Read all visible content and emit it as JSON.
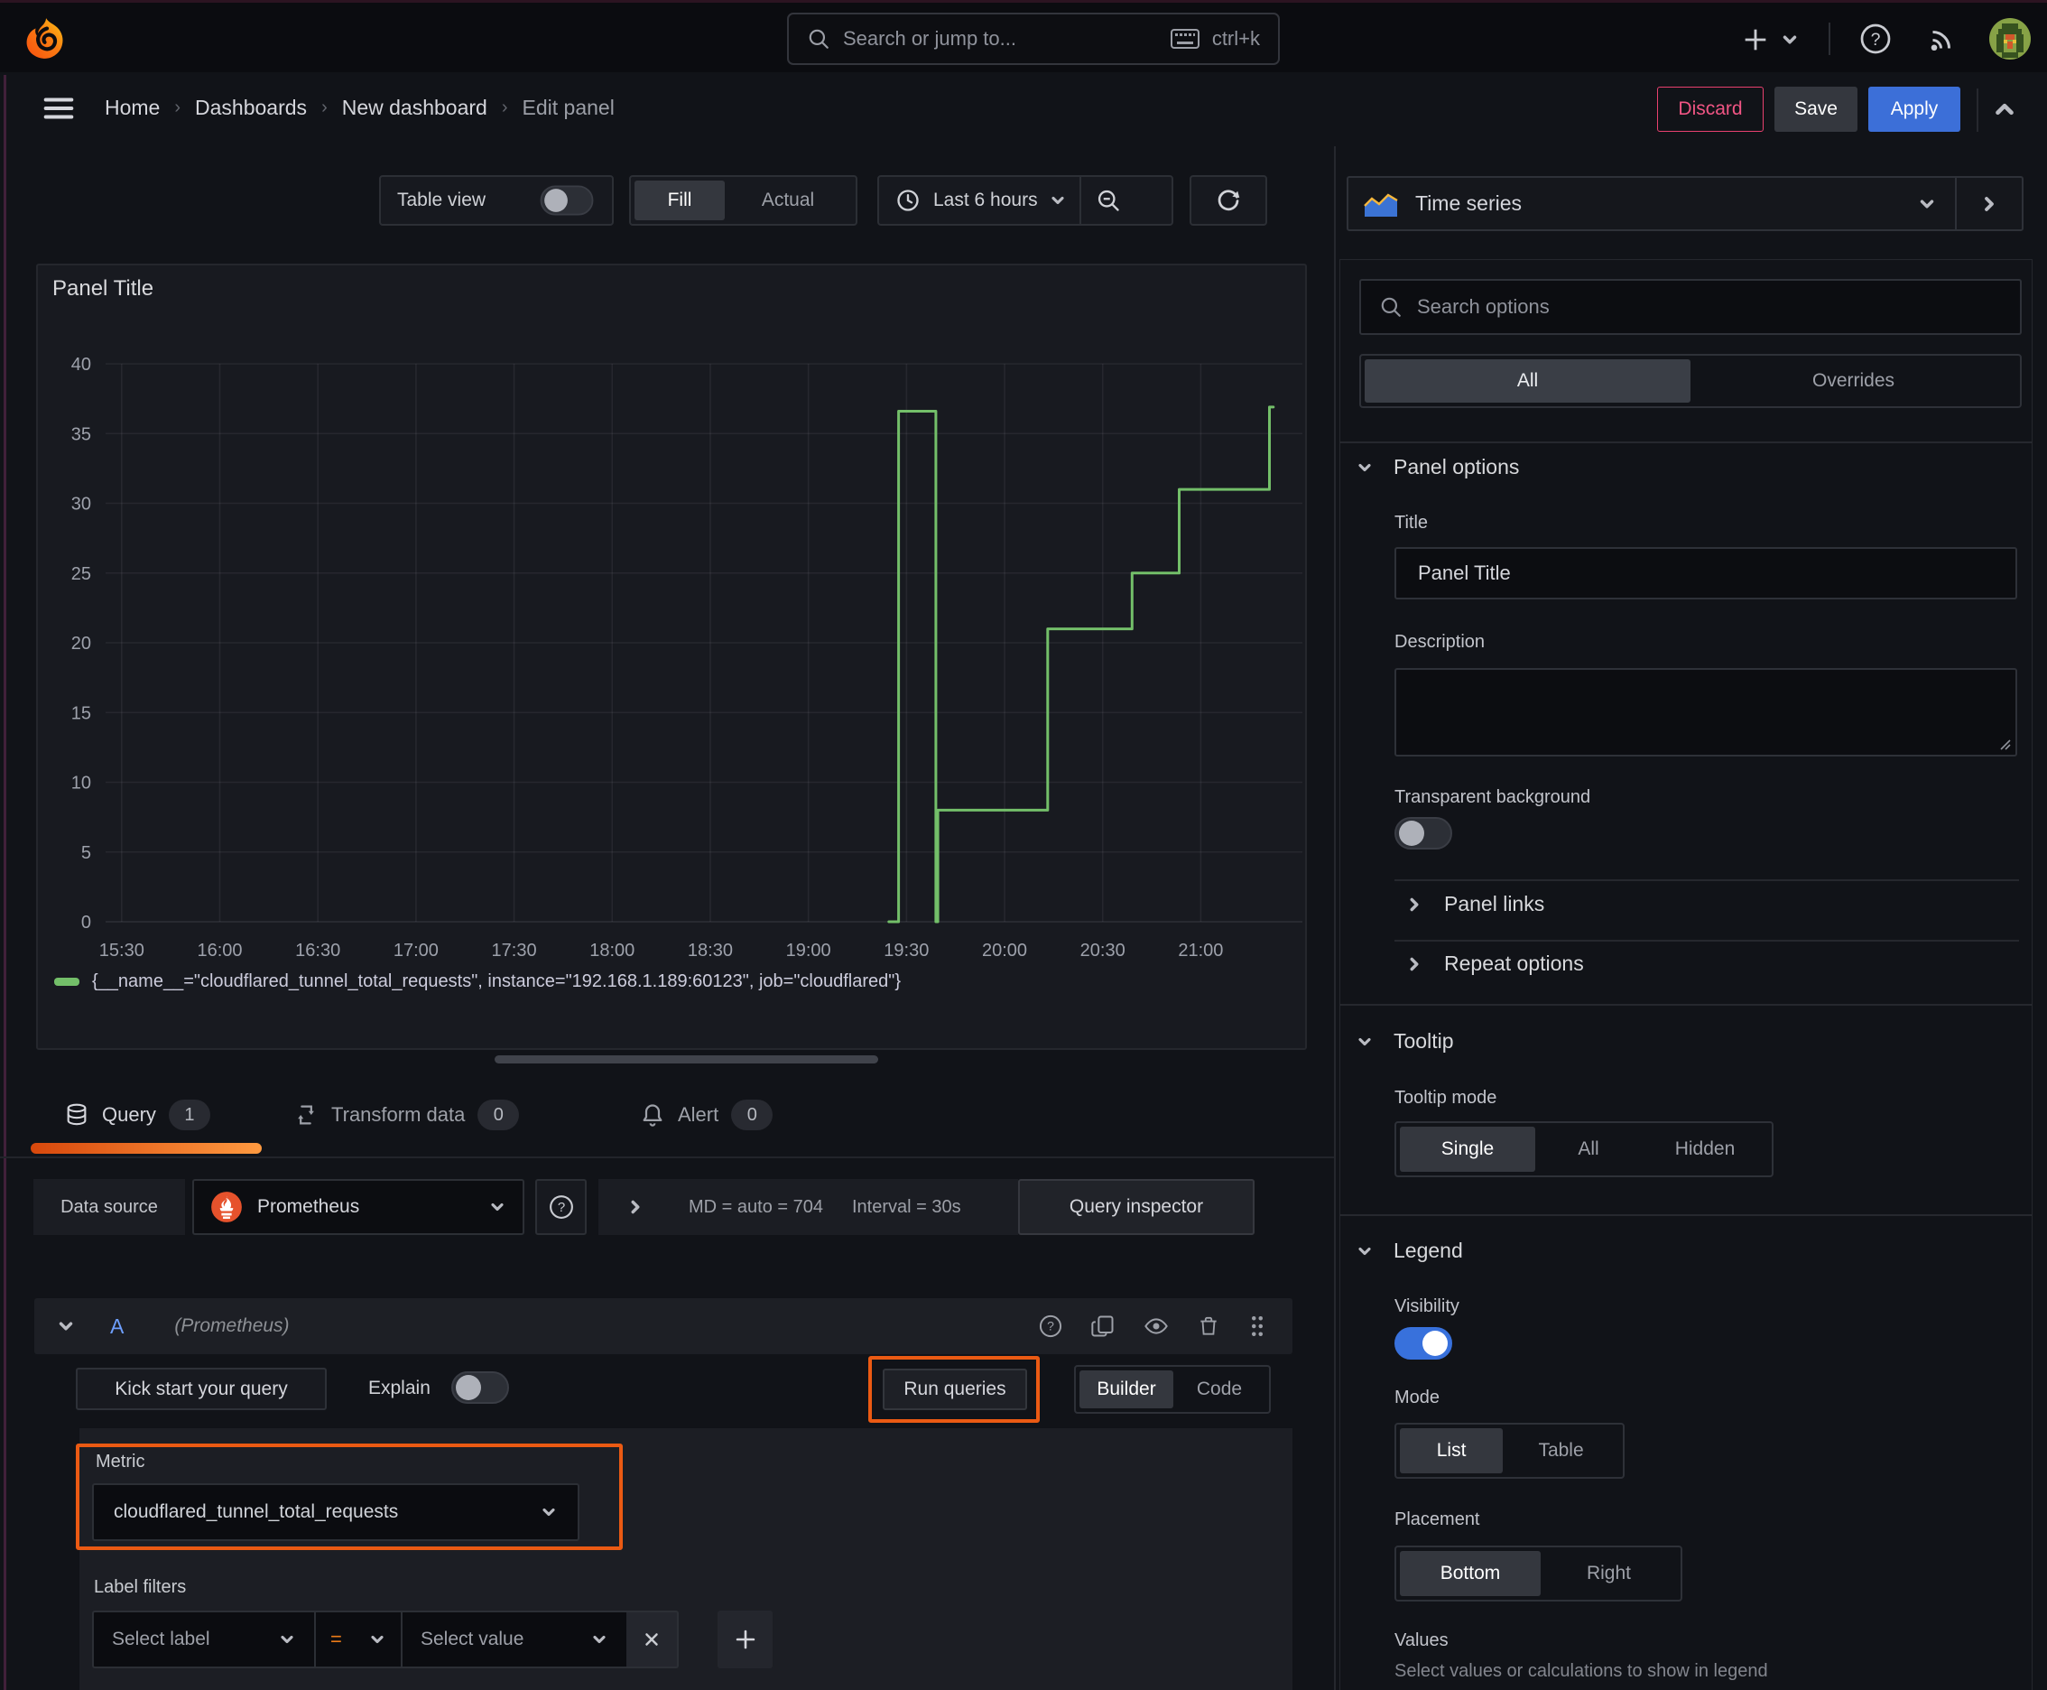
{
  "topbar": {
    "search_placeholder": "Search or jump to...",
    "shortcut": "ctrl+k"
  },
  "breadcrumb": {
    "items": [
      "Home",
      "Dashboards",
      "New dashboard",
      "Edit panel"
    ]
  },
  "actions": {
    "discard": "Discard",
    "save": "Save",
    "apply": "Apply"
  },
  "toolbar": {
    "table_view": "Table view",
    "fill": "Fill",
    "actual": "Actual",
    "time_range": "Last 6 hours"
  },
  "panel": {
    "title": "Panel Title"
  },
  "chart_data": {
    "type": "line",
    "title": "Panel Title",
    "line_style": "step-after",
    "x_tick_labels": [
      "15:30",
      "16:00",
      "16:30",
      "17:00",
      "17:30",
      "18:00",
      "18:30",
      "19:00",
      "19:30",
      "20:00",
      "20:30",
      "21:00"
    ],
    "x_tick_hours": [
      15.5,
      16,
      16.5,
      17,
      17.5,
      18,
      18.5,
      19,
      19.5,
      20,
      20.5,
      21
    ],
    "x_range_hours": [
      15.418,
      21.518
    ],
    "ylim": [
      0,
      40
    ],
    "y_ticks": [
      0,
      5,
      10,
      15,
      20,
      25,
      30,
      35,
      40
    ],
    "grid": true,
    "legend_position": "bottom",
    "series": [
      {
        "name": "{__name__=\"cloudflared_tunnel_total_requests\", instance=\"192.168.1.189:60123\", job=\"cloudflared\"}",
        "color": "#73bf69",
        "points_hours_value": [
          [
            19.41,
            0
          ],
          [
            19.46,
            0
          ],
          [
            19.46,
            36.6
          ],
          [
            19.65,
            36.6
          ],
          [
            19.65,
            0
          ],
          [
            19.66,
            0
          ],
          [
            19.66,
            8
          ],
          [
            20.22,
            8
          ],
          [
            20.22,
            21
          ],
          [
            20.65,
            21
          ],
          [
            20.65,
            25
          ],
          [
            20.89,
            25
          ],
          [
            20.89,
            31
          ],
          [
            21.35,
            31
          ],
          [
            21.35,
            36.9
          ],
          [
            21.37,
            36.9
          ]
        ]
      }
    ]
  },
  "tabs": {
    "query": {
      "label": "Query",
      "count": "1"
    },
    "transform": {
      "label": "Transform data",
      "count": "0"
    },
    "alert": {
      "label": "Alert",
      "count": "0"
    }
  },
  "datasource": {
    "label": "Data source",
    "name": "Prometheus",
    "summary_md": "MD = auto = 704",
    "summary_interval": "Interval = 30s",
    "query_inspector": "Query inspector"
  },
  "query_row": {
    "ref_id": "A",
    "ds_hint": "(Prometheus)"
  },
  "query_toolbar": {
    "kick_start": "Kick start your query",
    "explain": "Explain",
    "run_queries": "Run queries",
    "builder": "Builder",
    "code": "Code"
  },
  "builder": {
    "metric_label": "Metric",
    "metric_value": "cloudflared_tunnel_total_requests",
    "label_filters_label": "Label filters",
    "select_label": "Select label",
    "operator": "=",
    "select_value": "Select value"
  },
  "sidebar": {
    "viz_name": "Time series",
    "search_placeholder": "Search options",
    "tabs": {
      "all": "All",
      "overrides": "Overrides"
    },
    "panel_options": {
      "title": "Panel options",
      "title_label": "Title",
      "title_value": "Panel Title",
      "description_label": "Description",
      "transparent_label": "Transparent background"
    },
    "links_label": "Panel links",
    "repeat_label": "Repeat options",
    "tooltip": {
      "title": "Tooltip",
      "mode_label": "Tooltip mode",
      "modes": [
        "Single",
        "All",
        "Hidden"
      ]
    },
    "legend": {
      "title": "Legend",
      "visibility_label": "Visibility",
      "mode_label": "Mode",
      "modes": [
        "List",
        "Table"
      ],
      "placement_label": "Placement",
      "placements": [
        "Bottom",
        "Right"
      ],
      "values_label": "Values",
      "values_hint": "Select values or calculations to show in legend"
    }
  }
}
